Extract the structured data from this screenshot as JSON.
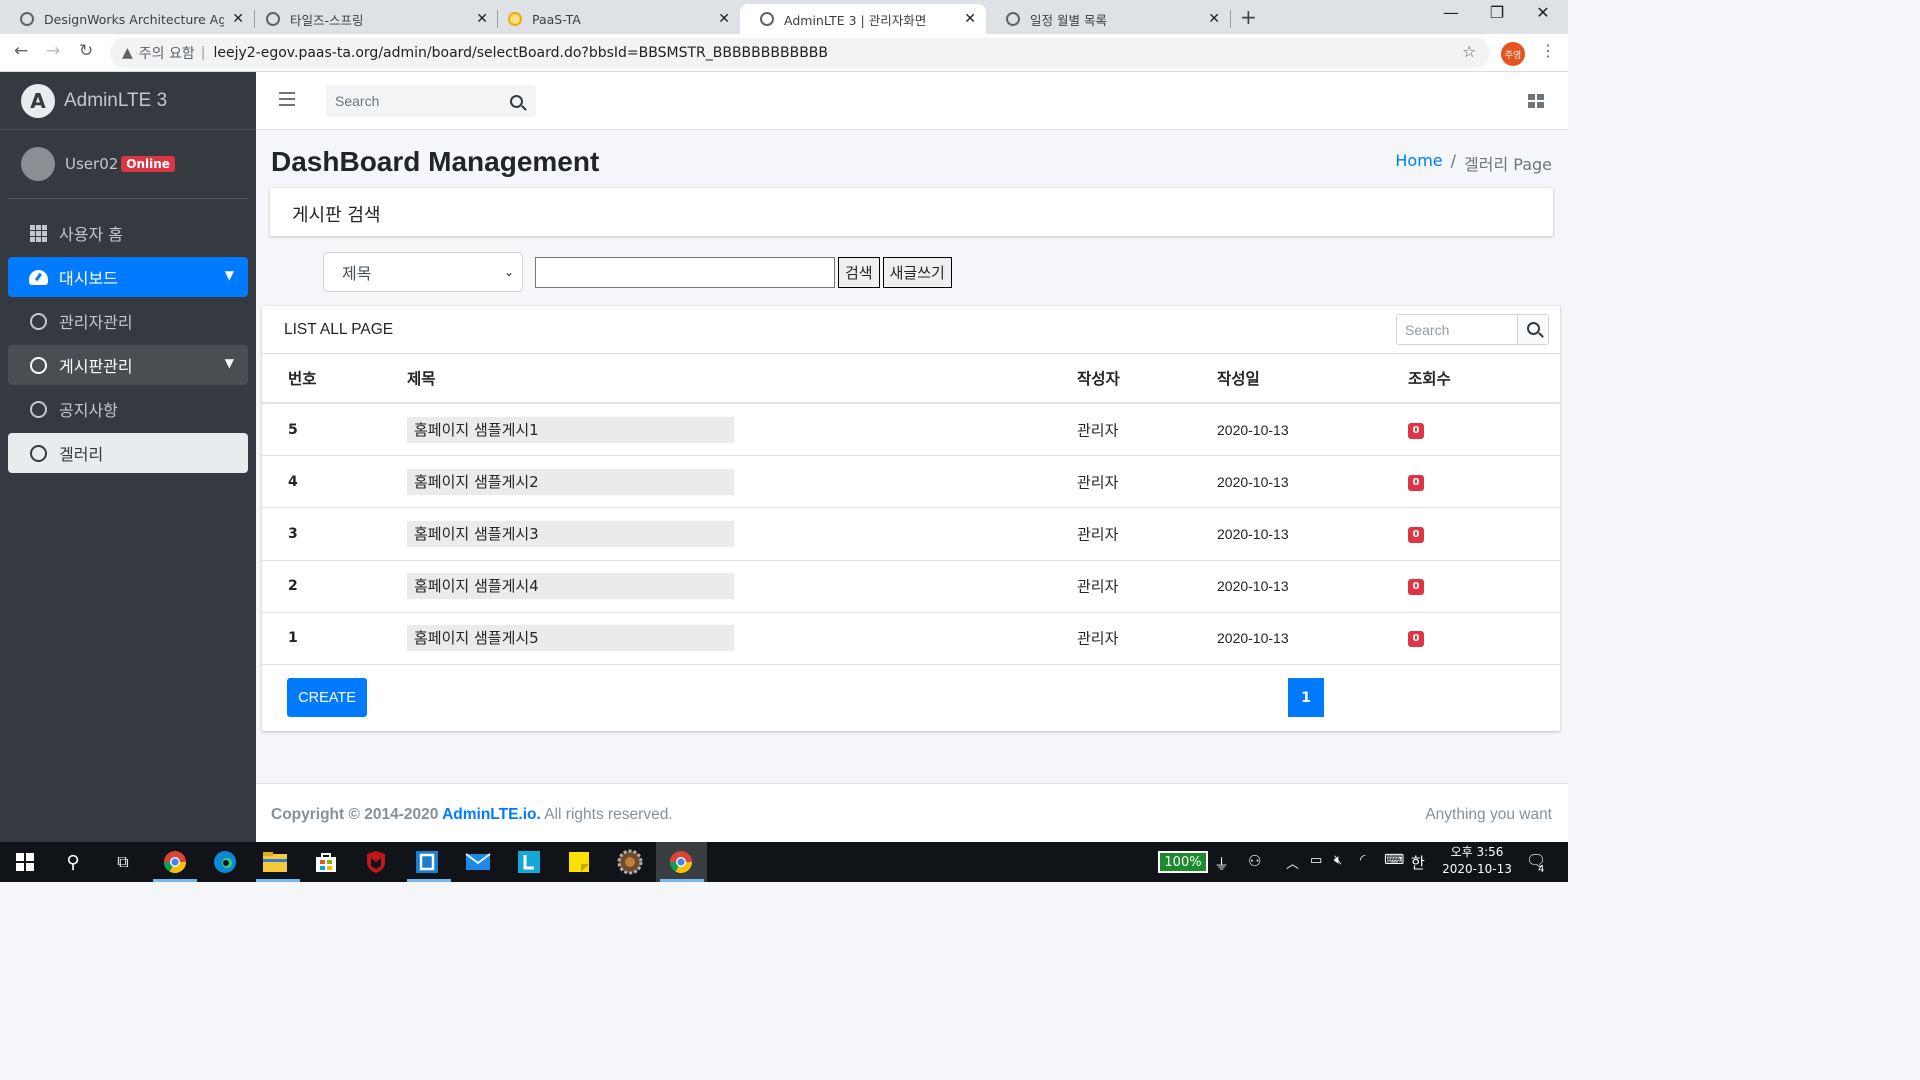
{
  "browser": {
    "tabs": [
      {
        "title": "DesignWorks Architecture Agen",
        "active": false,
        "favicon": "globe-icon"
      },
      {
        "title": "타일즈-스프링",
        "active": false,
        "favicon": "globe-icon"
      },
      {
        "title": "PaaS-TA",
        "active": false,
        "favicon": "paas-icon"
      },
      {
        "title": "AdminLTE 3 | 관리자화면",
        "active": true,
        "favicon": "globe-icon"
      },
      {
        "title": "일정 월별 목록",
        "active": false,
        "favicon": "globe-icon"
      }
    ],
    "security_label": "주의 요함",
    "url": "leejy2-egov.paas-ta.org/admin/board/selectBoard.do?bbsId=BBSMSTR_BBBBBBBBBBBB",
    "profile_label": "주영"
  },
  "sidebar": {
    "brand": "AdminLTE 3",
    "user": "User02",
    "status": "Online",
    "items": [
      {
        "label": "사용자 홈",
        "icon": "th-grid-icon",
        "state": "normal"
      },
      {
        "label": "대시보드",
        "icon": "dashboard-gauge-icon",
        "state": "active",
        "caret": true
      },
      {
        "label": "관리자관리",
        "icon": "circle-icon",
        "state": "normal"
      },
      {
        "label": "게시판관리",
        "icon": "circle-icon",
        "state": "open",
        "caret": true
      },
      {
        "label": "공지사항",
        "icon": "circle-icon",
        "state": "normal"
      },
      {
        "label": "겔러리",
        "icon": "circle-icon",
        "state": "selected"
      }
    ]
  },
  "topnav": {
    "search_placeholder": "Search"
  },
  "page": {
    "title": "DashBoard Management",
    "breadcrumb_home": "Home",
    "breadcrumb_sep": "/",
    "breadcrumb_current": "겔러리 Page",
    "search_card_title": "게시판 검색",
    "filter_selected": "제목",
    "search_button": "검색",
    "write_button": "새글쓰기"
  },
  "list": {
    "title": "LIST ALL PAGE",
    "search_placeholder": "Search",
    "columns": [
      "번호",
      "제목",
      "작성자",
      "작성일",
      "조회수"
    ],
    "rows": [
      {
        "no": "5",
        "title": "홈페이지 샘플게시1",
        "writer": "관리자",
        "date": "2020-10-13",
        "views": "0"
      },
      {
        "no": "4",
        "title": "홈페이지 샘플게시2",
        "writer": "관리자",
        "date": "2020-10-13",
        "views": "0"
      },
      {
        "no": "3",
        "title": "홈페이지 샘플게시3",
        "writer": "관리자",
        "date": "2020-10-13",
        "views": "0"
      },
      {
        "no": "2",
        "title": "홈페이지 샘플게시4",
        "writer": "관리자",
        "date": "2020-10-13",
        "views": "0"
      },
      {
        "no": "1",
        "title": "홈페이지 샘플게시5",
        "writer": "관리자",
        "date": "2020-10-13",
        "views": "0"
      }
    ],
    "create_button": "CREATE",
    "current_page": "1"
  },
  "footer": {
    "copyright_prefix": "Copyright © 2014-2020 ",
    "copyright_link": "AdminLTE.io.",
    "copyright_suffix": " All rights reserved.",
    "right_text": "Anything you want"
  },
  "taskbar": {
    "battery": "100%",
    "ime": "한",
    "time": "오후 3:56",
    "date": "2020-10-13",
    "notifications": "4"
  },
  "colors": {
    "primary": "#007bff",
    "danger": "#dc3545",
    "sidebar_bg": "#343a40"
  }
}
